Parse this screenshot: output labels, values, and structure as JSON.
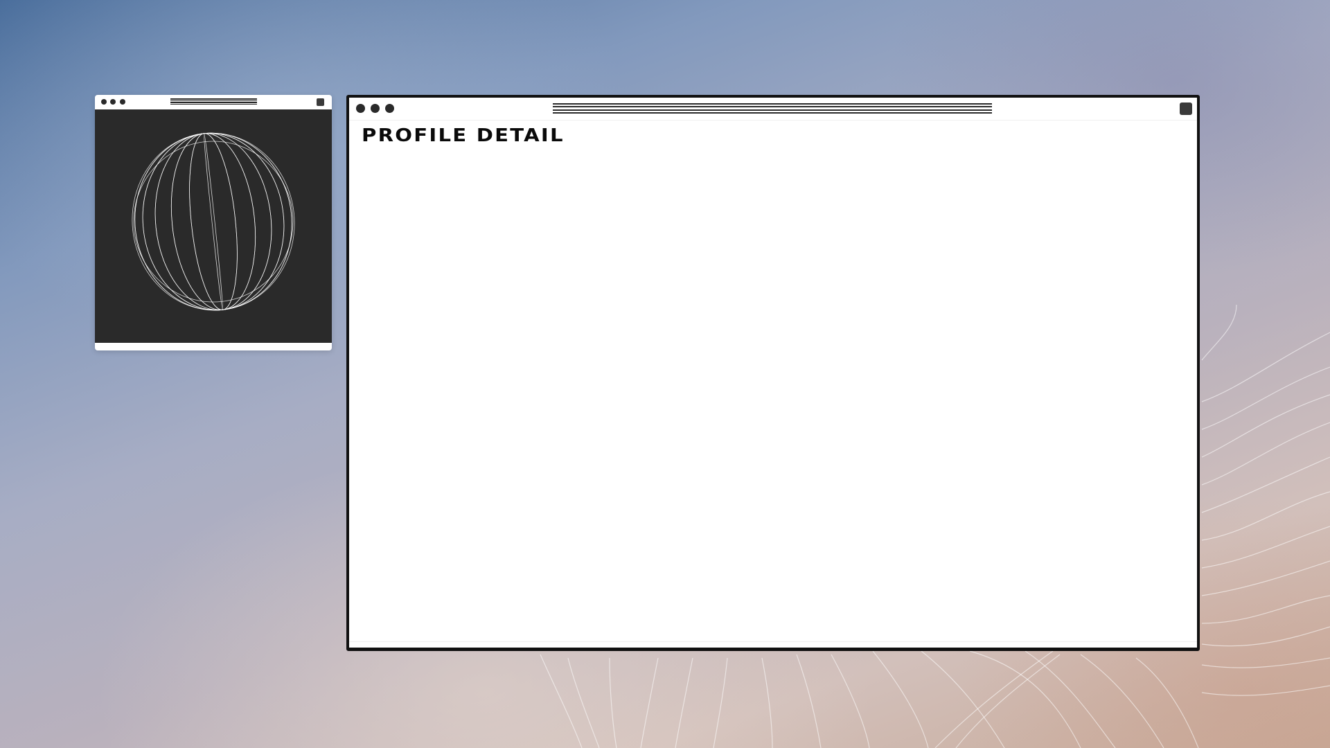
{
  "desktop": {
    "background_colors": [
      "#4a6e9c",
      "#a7adc4",
      "#d2c0bb",
      "#c8aa98"
    ]
  },
  "small_window": {
    "icon": "wireframe-globe-icon",
    "content_background": "#2a2a2a"
  },
  "main_window": {
    "title": "PROFILE DETAIL",
    "window_controls": [
      "dot",
      "dot",
      "dot"
    ],
    "close_icon": "square-icon"
  }
}
